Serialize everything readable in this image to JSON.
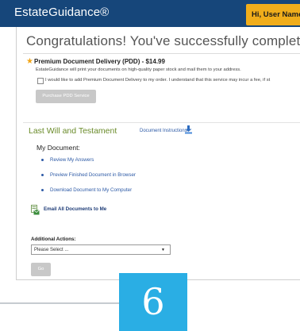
{
  "header": {
    "brand": "EstateGuidance®",
    "user_button": "Hi, User Name",
    "bg_color": "#16467a",
    "user_button_color": "#f0ad1b"
  },
  "main": {
    "congrats": "Congratulations! You've successfully completed all questionnaire",
    "pdd": {
      "title": "Premium Document Delivery (PDD) - $14.99",
      "description": "EstateGuidance will print your documents on high-quality paper stock and mail them to your address.",
      "checkbox_label": "I would like to add Premium Document Delivery to my order. I understand that this service may incur a fee, if st",
      "purchase_button": "Purchase PDD Service"
    },
    "lwt": {
      "title": "Last Will and Testament",
      "instructions_link": "Document Instructions",
      "my_document_heading": "My Document:",
      "links": [
        "Review My Answers",
        "Preview Finished Document in Browser",
        "Download Document to My Computer"
      ],
      "email_all": "Email All Documents to Me"
    },
    "additional": {
      "label": "Additional Actions:",
      "select_value": "Please Select ...",
      "go_button": "Go"
    }
  },
  "step_number": "6",
  "icons": {
    "star": "star-icon",
    "download": "download-icon",
    "email": "email-document-icon",
    "caret": "dropdown-caret-icon"
  }
}
